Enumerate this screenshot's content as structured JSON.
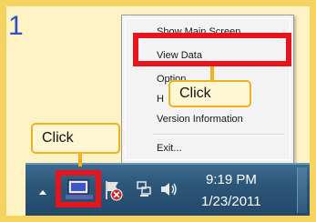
{
  "step_number": "1",
  "context_menu": {
    "items": [
      "Show Main Screen",
      "View Data",
      "Option",
      "H",
      "Version Information",
      "Exit..."
    ]
  },
  "callouts": {
    "menu_click": "Click",
    "tray_click": "Click"
  },
  "clock": {
    "time": "9:19 PM",
    "date": "1/23/2011"
  },
  "tray_icons": [
    "show-hidden-icons-arrow-icon",
    "app-monitor-icon",
    "action-center-flag-icon",
    "network-icon",
    "volume-icon"
  ],
  "colors": {
    "frame_border": "#f6d35e",
    "frame_background": "#fdf3c4",
    "highlight_red": "#e8141c",
    "callout_border": "#f2b21e",
    "step_number_blue": "#2f4fc4",
    "taskbar_blue": "#2c5779"
  }
}
